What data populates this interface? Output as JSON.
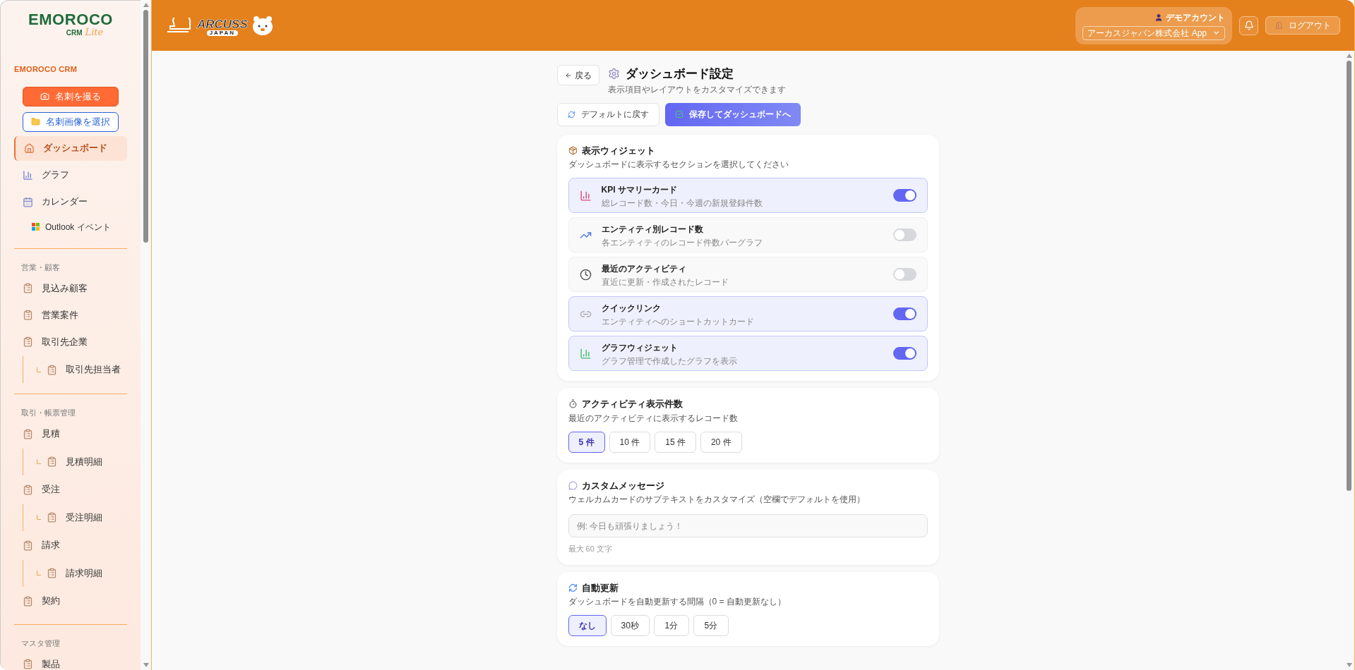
{
  "sidebar": {
    "logo": {
      "wordmark": "EMOROCO",
      "sub": "CRM",
      "tag": "Lite"
    },
    "brand": "EMOROCO CRM",
    "actions": [
      {
        "label": "名刺を撮る",
        "kind": "primary"
      },
      {
        "label": "名刺画像を選択",
        "kind": "secondary"
      }
    ],
    "sections": [
      {
        "items": [
          {
            "label": "ダッシュボード",
            "selected": true
          },
          {
            "label": "グラフ",
            "selected": false
          },
          {
            "label": "カレンダー",
            "selected": false,
            "children": [
              {
                "label": "Outlook イベント",
                "selected": false
              }
            ]
          }
        ]
      },
      {
        "title": "営業・顧客",
        "items": [
          {
            "label": "見込み顧客",
            "selected": false
          },
          {
            "label": "営業案件",
            "selected": false
          },
          {
            "label": "取引先企業",
            "selected": false,
            "children": [
              {
                "label": "取引先担当者",
                "selected": false
              }
            ]
          }
        ]
      },
      {
        "title": "取引・帳票管理",
        "items": [
          {
            "label": "見積",
            "selected": false,
            "children": [
              {
                "label": "見積明細",
                "selected": false
              }
            ]
          },
          {
            "label": "受注",
            "selected": false,
            "children": [
              {
                "label": "受注明細",
                "selected": false
              }
            ]
          },
          {
            "label": "請求",
            "selected": false,
            "children": [
              {
                "label": "請求明細",
                "selected": false
              }
            ]
          },
          {
            "label": "契約",
            "selected": false
          }
        ]
      },
      {
        "title": "マスタ管理",
        "items": [
          {
            "label": "製品",
            "selected": false
          }
        ]
      }
    ]
  },
  "header": {
    "logo": {
      "name": "ARCUSS",
      "sub": "JAPAN"
    },
    "account": {
      "name": "デモアカウント",
      "company": "アーカスジャパン株式会社 App"
    },
    "logout": "ログアウト"
  },
  "page": {
    "back": "戻る",
    "title": "ダッシュボード設定",
    "subtitle": "表示項目やレイアウトをカスタマイズできます",
    "reset": "デフォルトに戻す",
    "save": "保存してダッシュボードへ",
    "cards": [
      {
        "kind": "toggles",
        "title": "表示ウィジェット",
        "description": "ダッシュボードに表示するセクションを選択してください",
        "widgets": [
          {
            "title": "KPI サマリーカード",
            "description": "総レコード数・今日・今週の新規登録件数",
            "on": true
          },
          {
            "title": "エンティティ別レコード数",
            "description": "各エンティティのレコード件数バーグラフ",
            "on": false
          },
          {
            "title": "最近のアクティビティ",
            "description": "直近に更新・作成されたレコード",
            "on": false
          },
          {
            "title": "クイックリンク",
            "description": "エンティティへのショートカットカード",
            "on": true
          },
          {
            "title": "グラフウィジェット",
            "description": "グラフ管理で作成したグラフを表示",
            "on": true
          }
        ]
      },
      {
        "kind": "choices",
        "title": "アクティビティ表示件数",
        "description": "最近のアクティビティに表示するレコード数",
        "options": [
          {
            "label": "5 件",
            "selected": true
          },
          {
            "label": "10 件",
            "selected": false
          },
          {
            "label": "15 件",
            "selected": false
          },
          {
            "label": "20 件",
            "selected": false
          }
        ]
      },
      {
        "kind": "text",
        "title": "カスタムメッセージ",
        "description": "ウェルカムカードのサブテキストをカスタマイズ（空欄でデフォルトを使用）",
        "placeholder": "例: 今日も頑張りましょう！",
        "note": "最大 60 文字"
      },
      {
        "kind": "choices",
        "title": "自動更新",
        "description": "ダッシュボードを自動更新する間隔（0 = 自動更新なし）",
        "options": [
          {
            "label": "なし",
            "selected": true
          },
          {
            "label": "30秒",
            "selected": false
          },
          {
            "label": "1分",
            "selected": false
          },
          {
            "label": "5分",
            "selected": false
          }
        ]
      }
    ]
  }
}
